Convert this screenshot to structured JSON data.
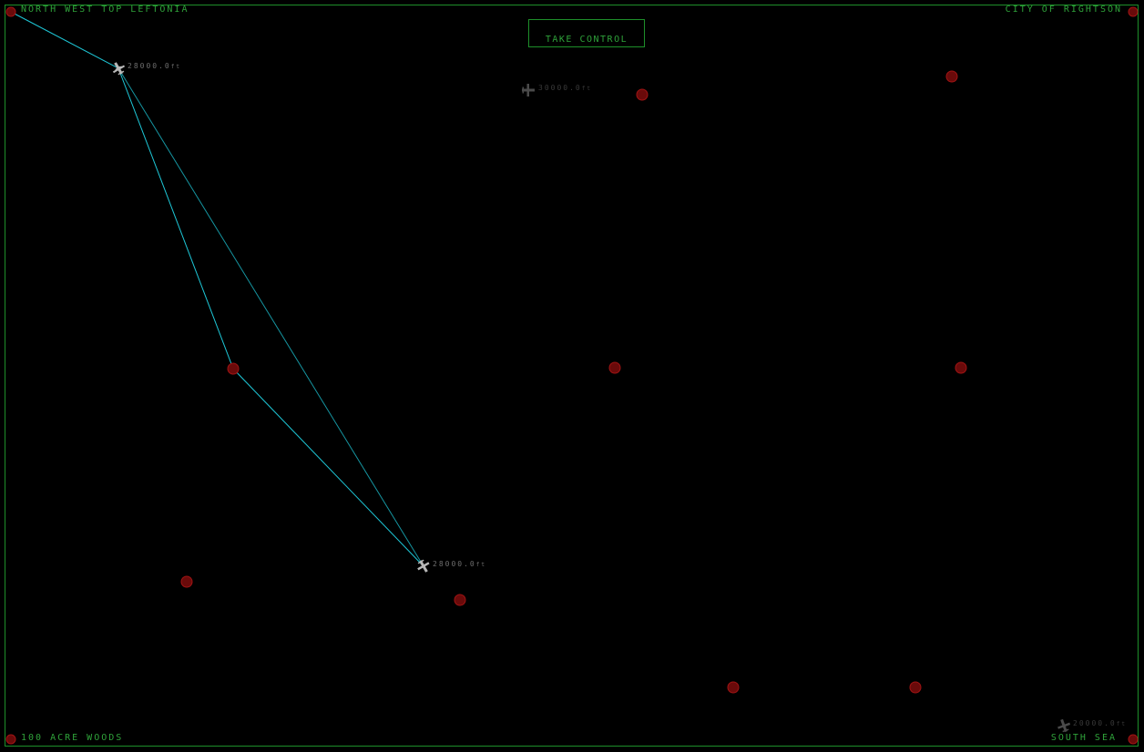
{
  "labels": {
    "nw": "NORTH WEST TOP LEFTONIA",
    "ne": "CITY OF RIGHTSON",
    "sw": "100 ACRE WOODS",
    "se": "SOUTH SEA"
  },
  "buttons": {
    "take_control": "TAKE CONTROL"
  },
  "aircraft": [
    {
      "id": "plane-1",
      "altitude": "28000.0",
      "unit": "ft",
      "state": "selected"
    },
    {
      "id": "plane-2",
      "altitude": "30000.0",
      "unit": "ft",
      "state": "dim"
    },
    {
      "id": "plane-3",
      "altitude": "28000.0",
      "unit": "ft",
      "state": "selected"
    },
    {
      "id": "plane-4",
      "altitude": "20000.0",
      "unit": "ft",
      "state": "dim"
    }
  ],
  "colors": {
    "border": "#1e8f2a",
    "text": "#2fa23a",
    "waypoint": "#8a0f0f",
    "route": "#1ec8d8",
    "aircraft_active": "#b8b8b8",
    "aircraft_dim": "#4a4a4a"
  },
  "icons": {
    "aircraft": "airplane-icon",
    "waypoint": "waypoint-icon"
  }
}
